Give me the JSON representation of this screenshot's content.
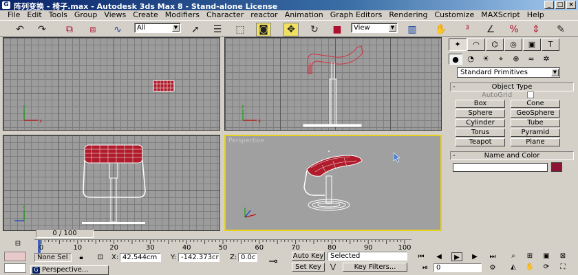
{
  "window": {
    "title": "阵列变换 - 椅子.max - Autodesk 3ds Max 8 - Stand-alone License",
    "app_icon_glyph": "G"
  },
  "menu": [
    "File",
    "Edit",
    "Tools",
    "Group",
    "Views",
    "Create",
    "Modifiers",
    "Character",
    "reactor",
    "Animation",
    "Graph Editors",
    "Rendering",
    "Customize",
    "MAXScript",
    "Help"
  ],
  "toolbar": {
    "selection_filter": "All",
    "reference_coord": "View",
    "icons": [
      "undo-icon",
      "redo-icon",
      "select-link-icon",
      "unlink-icon",
      "bind-space-warp-icon",
      "select-object-icon",
      "select-by-name-icon",
      "rectangular-selection-icon",
      "window-crossing-icon",
      "select-move-icon",
      "select-rotate-icon",
      "select-scale-icon",
      "pivot-icon",
      "select-manipulate-icon",
      "snap-icon",
      "angle-snap-icon",
      "percent-snap-icon",
      "spinner-snap-icon",
      "edit-named-selection-icon"
    ]
  },
  "viewports": {
    "perspective_label": "Perspective"
  },
  "command_panel": {
    "category": "Standard Primitives",
    "object_type_title": "Object Type",
    "autogrid_label": "AutoGrid",
    "buttons": [
      "Box",
      "Cone",
      "Sphere",
      "GeoSphere",
      "Cylinder",
      "Tube",
      "Torus",
      "Pyramid",
      "Teapot",
      "Plane"
    ],
    "name_color_title": "Name and Color",
    "object_color": "#8c1434",
    "rollout_sign": "-"
  },
  "timeline": {
    "frame_readout": "0 / 100",
    "ticks": [
      "0",
      "10",
      "20",
      "30",
      "40",
      "50",
      "60",
      "70",
      "80",
      "90",
      "100"
    ],
    "current_frame": 0
  },
  "status": {
    "selection": "None Sel",
    "x_label": "X:",
    "x_value": "42.544cm",
    "y_label": "Y:",
    "y_value": "-142.373cr",
    "z_label": "Z:",
    "z_value": "0.0c",
    "auto_key": "Auto Key",
    "set_key": "Set Key",
    "key_mode": "Selected",
    "key_filters": "Key Filters...",
    "frame_field": "0",
    "taskbar_item": "Perspective..."
  },
  "colors": {
    "active_viewport_border": "#e6d01c",
    "object_wire": "#ffffff",
    "object_red": "#b01c2c"
  }
}
